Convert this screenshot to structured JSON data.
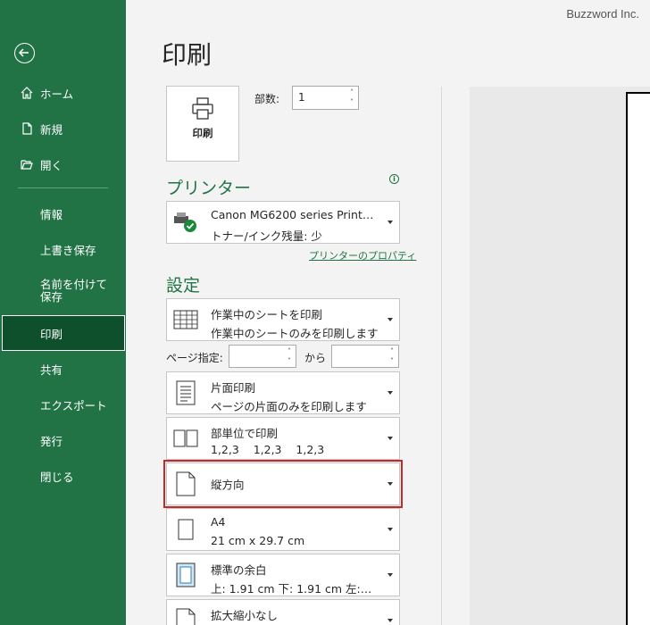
{
  "brand": "Buzzword Inc.",
  "sidebar": {
    "top_items": [
      {
        "label": "ホーム",
        "icon": "home-icon"
      },
      {
        "label": "新規",
        "icon": "new-document-icon"
      },
      {
        "label": "開く",
        "icon": "open-folder-icon"
      }
    ],
    "bottom_items": [
      {
        "label": "情報"
      },
      {
        "label": "上書き保存"
      },
      {
        "label": "名前を付けて保存"
      },
      {
        "label": "印刷"
      },
      {
        "label": "共有"
      },
      {
        "label": "エクスポート"
      },
      {
        "label": "発行"
      },
      {
        "label": "閉じる"
      }
    ],
    "active": "印刷"
  },
  "main": {
    "title": "印刷",
    "print_button": "印刷",
    "copies_label": "部数:",
    "copies_value": "1",
    "printer_heading": "プリンター",
    "printer": {
      "name": "Canon MG6200 series Print…",
      "status": "トナー/インク残量: 少"
    },
    "printer_properties": "プリンターのプロパティ",
    "settings_heading": "設定",
    "settings": [
      {
        "l1": "作業中のシートを印刷",
        "l2": "作業中のシートのみを印刷します"
      },
      {
        "l1": "片面印刷",
        "l2": "ページの片面のみを印刷します"
      },
      {
        "l1": "部単位で印刷",
        "l2": "1,2,3    1,2,3    1,2,3"
      },
      {
        "l1": "縦方向"
      },
      {
        "l1": "A4",
        "l2": "21 cm x 29.7 cm"
      },
      {
        "l1": "標準の余白",
        "l2": "上: 1.91 cm 下: 1.91 cm 左:…"
      },
      {
        "l1": "拡大縮小なし",
        "l2": ""
      }
    ],
    "page_range_label": "ページ指定:",
    "page_range_to": "から"
  },
  "colors": {
    "sidebar": "#217346",
    "active": "#0e4f2c",
    "highlight": "#c62828"
  }
}
